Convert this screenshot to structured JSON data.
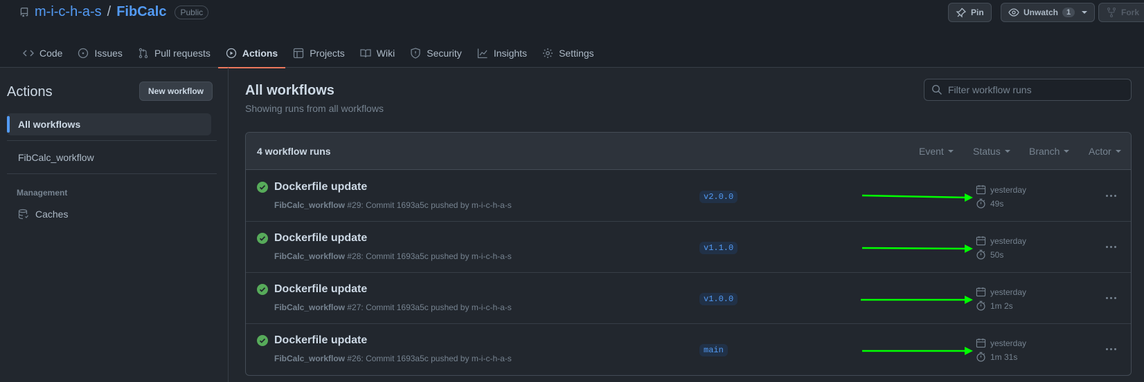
{
  "repo": {
    "owner": "m-i-c-h-a-s",
    "separator": "/",
    "name": "FibCalc",
    "visibility": "Public"
  },
  "header_actions": {
    "pin_label": "Pin",
    "watch_label": "Unwatch",
    "watch_count": "1",
    "fork_label": "Fork"
  },
  "tabs": [
    {
      "label": "Code",
      "icon": "code-icon"
    },
    {
      "label": "Issues",
      "icon": "issue-icon"
    },
    {
      "label": "Pull requests",
      "icon": "pull-request-icon"
    },
    {
      "label": "Actions",
      "icon": "play-icon",
      "active": true
    },
    {
      "label": "Projects",
      "icon": "table-icon"
    },
    {
      "label": "Wiki",
      "icon": "book-icon"
    },
    {
      "label": "Security",
      "icon": "shield-icon"
    },
    {
      "label": "Insights",
      "icon": "graph-icon"
    },
    {
      "label": "Settings",
      "icon": "gear-icon"
    }
  ],
  "sidebar": {
    "title": "Actions",
    "new_workflow_label": "New workflow",
    "items": [
      {
        "label": "All workflows",
        "active": true
      },
      {
        "label": "FibCalc_workflow"
      }
    ],
    "section_label": "Management",
    "caches_label": "Caches"
  },
  "main": {
    "title": "All workflows",
    "subtitle": "Showing runs from all workflows",
    "filter_placeholder": "Filter workflow runs",
    "runs_count": "4 workflow runs",
    "filters": [
      "Event",
      "Status",
      "Branch",
      "Actor"
    ]
  },
  "runs": [
    {
      "title": "Dockerfile update",
      "workflow": "FibCalc_workflow",
      "detail": "#29: Commit 1693a5c pushed by m-i-c-h-a-s",
      "branch": "v2.0.0",
      "when": "yesterday",
      "duration": "49s"
    },
    {
      "title": "Dockerfile update",
      "workflow": "FibCalc_workflow",
      "detail": "#28: Commit 1693a5c pushed by m-i-c-h-a-s",
      "branch": "v1.1.0",
      "when": "yesterday",
      "duration": "50s"
    },
    {
      "title": "Dockerfile update",
      "workflow": "FibCalc_workflow",
      "detail": "#27: Commit 1693a5c pushed by m-i-c-h-a-s",
      "branch": "v1.0.0",
      "when": "yesterday",
      "duration": "1m 2s"
    },
    {
      "title": "Dockerfile update",
      "workflow": "FibCalc_workflow",
      "detail": "#26: Commit 1693a5c pushed by m-i-c-h-a-s",
      "branch": "main",
      "when": "yesterday",
      "duration": "1m 31s"
    }
  ],
  "colors": {
    "success": "#57ab5a",
    "accent": "#539bf5",
    "annotation_arrow": "#00ff00",
    "active_tab_underline": "#ec775c"
  }
}
